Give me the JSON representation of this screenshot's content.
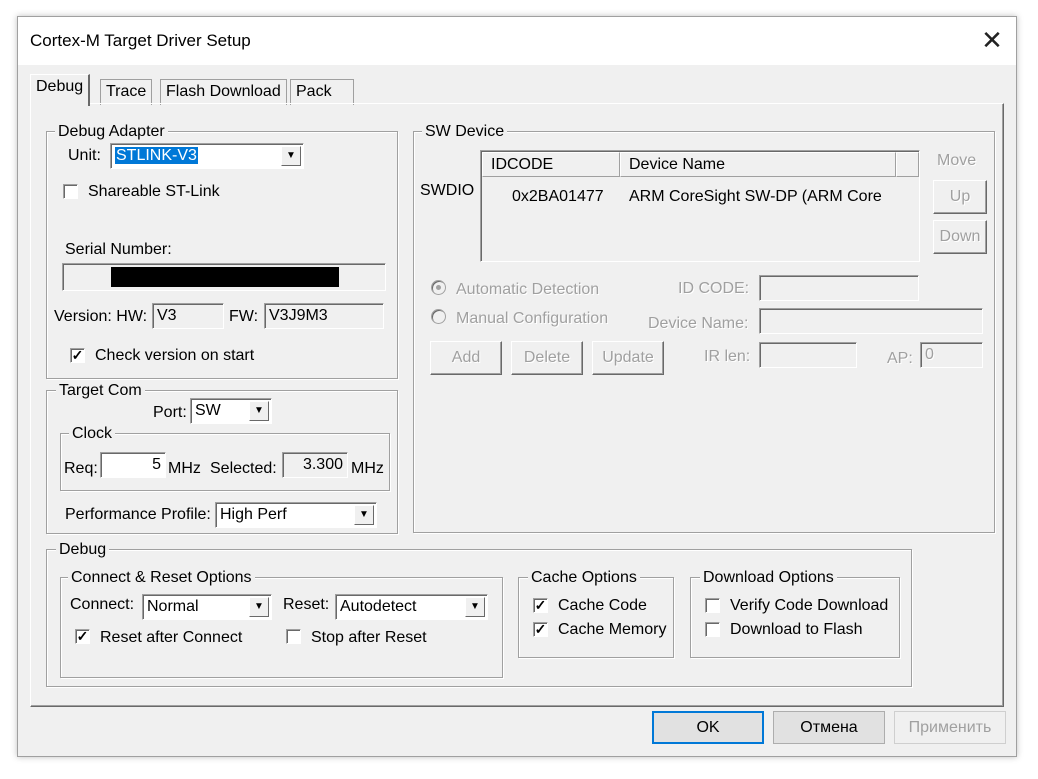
{
  "window": {
    "title": "Cortex-M Target Driver Setup",
    "close_glyph": "✕"
  },
  "tabs": [
    "Debug",
    "Trace",
    "Flash Download",
    "Pack"
  ],
  "debug_adapter": {
    "legend": "Debug Adapter",
    "unit_label": "Unit:",
    "unit_value": "STLINK-V3",
    "shareable_label": "Shareable ST-Link",
    "shareable_checked": false,
    "serial_label": "Serial Number:",
    "version_label": "Version: HW:",
    "hw_value": "V3",
    "fw_label": "FW:",
    "fw_value": "V3J9M3",
    "check_version_label": "Check version on start",
    "check_version_checked": true
  },
  "target_com": {
    "legend": "Target Com",
    "port_label": "Port:",
    "port_value": "SW",
    "clock_legend": "Clock",
    "req_label": "Req:",
    "req_value": "5",
    "mhz1": "MHz",
    "selected_label": "Selected:",
    "selected_value": "3.300",
    "mhz2": "MHz",
    "perf_label": "Performance Profile:",
    "perf_value": "High Perf"
  },
  "sw_device": {
    "legend": "SW Device",
    "swdio_label": "SWDIO",
    "col_idcode": "IDCODE",
    "col_device": "Device Name",
    "row_idcode": "0x2BA01477",
    "row_device": "ARM CoreSight SW-DP (ARM Core",
    "move_label": "Move",
    "up_label": "Up",
    "down_label": "Down",
    "auto_label": "Automatic Detection",
    "manual_label": "Manual Configuration",
    "idcode_label": "ID CODE:",
    "devname_label": "Device Name:",
    "add_label": "Add",
    "delete_label": "Delete",
    "update_label": "Update",
    "irlen_label": "IR len:",
    "ap_label": "AP:",
    "ap_value": "0"
  },
  "debug": {
    "legend": "Debug",
    "connect_reset_legend": "Connect & Reset Options",
    "connect_label": "Connect:",
    "connect_value": "Normal",
    "reset_label": "Reset:",
    "reset_value": "Autodetect",
    "reset_after_connect_label": "Reset after Connect",
    "reset_after_connect_checked": true,
    "stop_after_reset_label": "Stop after Reset",
    "stop_after_reset_checked": false,
    "cache_legend": "Cache Options",
    "cache_code_label": "Cache Code",
    "cache_code_checked": true,
    "cache_memory_label": "Cache Memory",
    "cache_memory_checked": true,
    "download_legend": "Download Options",
    "verify_label": "Verify Code Download",
    "verify_checked": false,
    "download_flash_label": "Download to Flash",
    "download_flash_checked": false
  },
  "footer": {
    "ok": "OK",
    "cancel": "Отмена",
    "apply": "Применить"
  }
}
